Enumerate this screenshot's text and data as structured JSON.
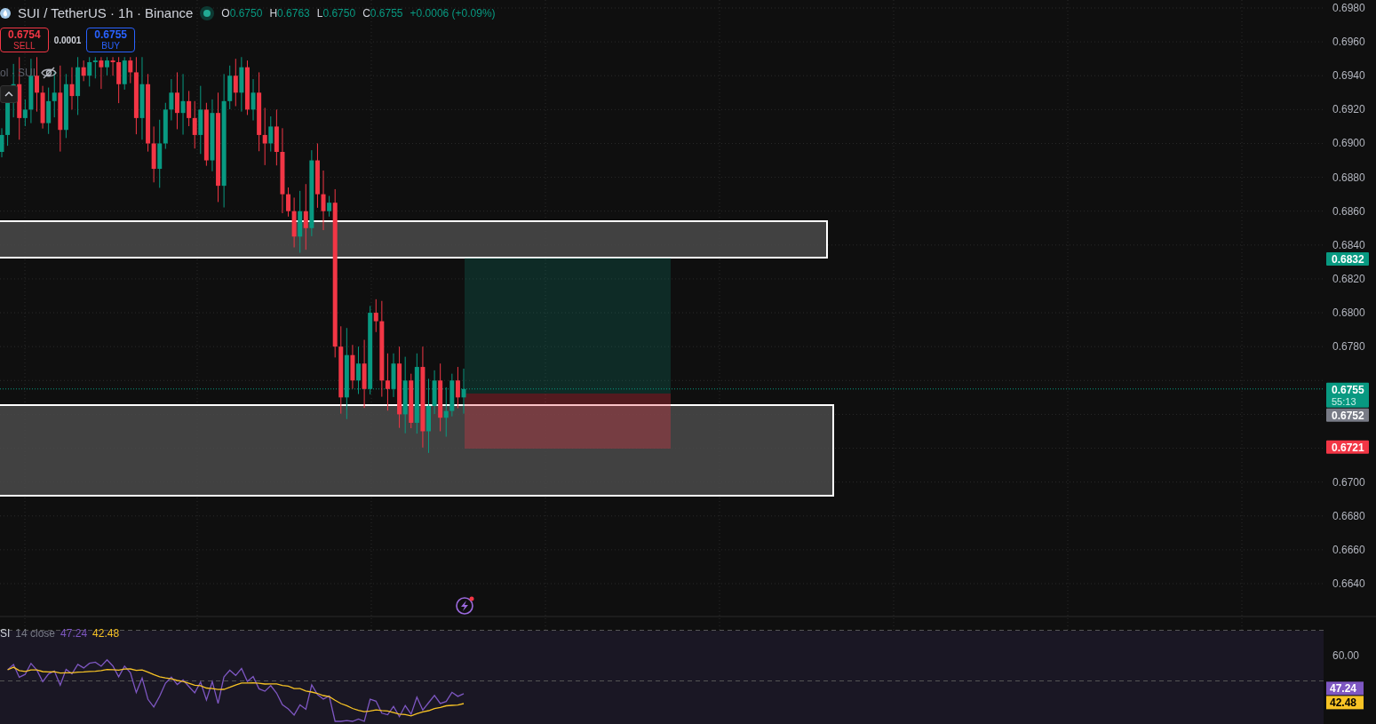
{
  "legend": {
    "symbol": "SUI / TetherUS · 1h · Binance",
    "market_open": true,
    "ohlc": [
      {
        "label": "O",
        "value": "0.6750"
      },
      {
        "label": "H",
        "value": "0.6763"
      },
      {
        "label": "L",
        "value": "0.6750"
      },
      {
        "label": "C",
        "value": "0.6755"
      }
    ],
    "change": "+0.0006 (+0.09%)"
  },
  "trade": {
    "sell_price": "0.6754",
    "sell_label": "SELL",
    "spread": "0.0001",
    "buy_price": "0.6755",
    "buy_label": "BUY"
  },
  "volume_legend": {
    "text": "ol · SUI",
    "hidden": true
  },
  "price_axis": {
    "ticks": [
      "0.6980",
      "0.6960",
      "0.6940",
      "0.6920",
      "0.6900",
      "0.6880",
      "0.6860",
      "0.6840",
      "0.6820",
      "0.6800",
      "0.6780",
      "0.6700",
      "0.6680",
      "0.6660",
      "0.6640"
    ],
    "markers": [
      {
        "kind": "target",
        "value": "0.6832"
      },
      {
        "kind": "last",
        "value": "0.6755",
        "countdown": "55:13"
      },
      {
        "kind": "entry",
        "value": "0.6752"
      },
      {
        "kind": "stop",
        "value": "0.6721"
      }
    ]
  },
  "rsi": {
    "title": "SI",
    "params": "14 close",
    "rsi_value": "47.24",
    "ma_value": "42.48",
    "axis_ticks": [
      "60.00"
    ],
    "markers": [
      {
        "kind": "rsi",
        "value": "47.24"
      },
      {
        "kind": "ma",
        "value": "42.48"
      }
    ]
  }
}
